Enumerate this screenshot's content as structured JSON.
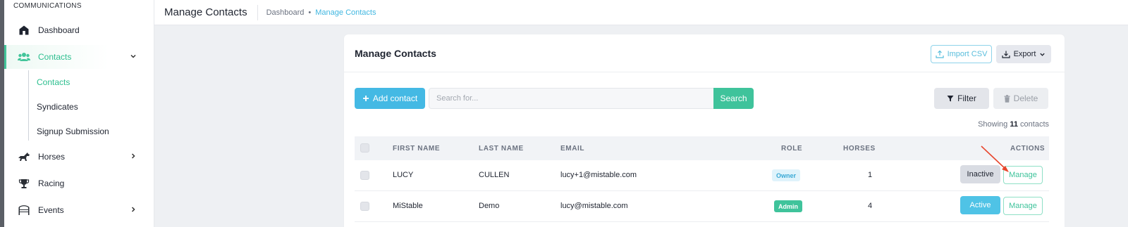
{
  "sidebar": {
    "section_label": "COMMUNICATIONS",
    "items": [
      {
        "label": "Dashboard",
        "icon": "home-icon"
      },
      {
        "label": "Contacts",
        "icon": "users-icon",
        "active": true,
        "expanded": true
      },
      {
        "label": "Horses",
        "icon": "horse-icon"
      },
      {
        "label": "Racing",
        "icon": "trophy-icon"
      },
      {
        "label": "Events",
        "icon": "gate-icon"
      }
    ],
    "sub_items": [
      {
        "label": "Contacts",
        "active": true
      },
      {
        "label": "Syndicates"
      },
      {
        "label": "Signup Submission"
      }
    ]
  },
  "header": {
    "title": "Manage Contacts",
    "breadcrumb": [
      "Dashboard",
      "Manage Contacts"
    ]
  },
  "card": {
    "title": "Manage Contacts",
    "import_label": "Import CSV",
    "export_label": "Export",
    "add_label": "Add contact",
    "search_placeholder": "Search for...",
    "search_label": "Search",
    "filter_label": "Filter",
    "delete_label": "Delete",
    "showing_prefix": "Showing",
    "showing_count": "11",
    "showing_suffix": "contacts"
  },
  "table": {
    "columns": [
      "FIRST NAME",
      "LAST NAME",
      "EMAIL",
      "ROLE",
      "HORSES",
      "ACTIONS"
    ],
    "rows": [
      {
        "first": "LUCY",
        "last": "CULLEN",
        "email": "lucy+1@mistable.com",
        "role": "Owner",
        "horses": "1",
        "status": "Inactive",
        "action": "Manage"
      },
      {
        "first": "MiStable",
        "last": "Demo",
        "email": "lucy@mistable.com",
        "role": "Admin",
        "horses": "4",
        "status": "Active",
        "action": "Manage"
      }
    ]
  },
  "colors": {
    "accent_green": "#3fc39b",
    "accent_blue": "#44b9e4",
    "annotation_arrow": "#e8452c"
  }
}
